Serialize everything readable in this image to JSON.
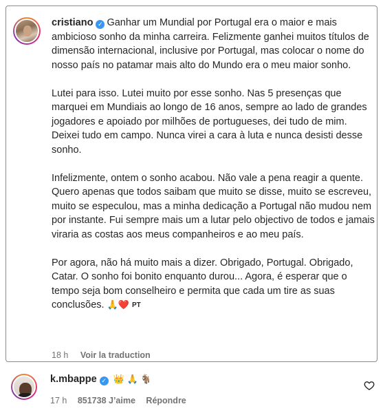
{
  "post": {
    "username": "cristiano",
    "paragraphs": [
      "Ganhar um Mundial por Portugal era o maior e mais ambicioso sonho da minha carreira. Felizmente ganhei muitos títulos de dimensão internacional, inclusive por Portugal, mas colocar o nome do nosso país no patamar mais alto do Mundo era o meu maior sonho.",
      "Lutei para isso. Lutei muito por esse sonho. Nas 5 presenças que marquei em Mundiais ao longo de 16 anos, sempre ao lado de grandes jogadores e apoiado por milhões de portugueses, dei tudo de mim. Deixei tudo em campo. Nunca virei a cara à luta e nunca desisti desse sonho.",
      "Infelizmente, ontem o sonho acabou. Não vale a pena reagir a quente. Quero apenas que todos saibam que muito se disse, muito se escreveu, muito se especulou, mas a minha dedicação a Portugal não mudou nem por instante. Fui sempre mais um a lutar pelo objectivo de todos e jamais viraria as costas aos meus companheiros e ao meu país.",
      "Por agora, não há muito mais a dizer. Obrigado, Portugal. Obrigado, Catar. O sonho foi bonito enquanto durou... Agora, é esperar que o tempo seja bom conselheiro e permita que cada um tire as suas conclusões."
    ],
    "end_emoji": "🙏",
    "end_heart": "❤️",
    "end_flag": "PT",
    "time": "18 h",
    "translation_link": "Voir la traduction"
  },
  "reply": {
    "username": "k.mbappe",
    "emojis": "👑 🙏 🐐",
    "time": "17 h",
    "likes": "851738 J’aime",
    "reply_link": "Répondre"
  },
  "colors": {
    "verified": "#3897f0",
    "text": "#262626",
    "secondary": "#737373",
    "heart": "#e0245e"
  }
}
